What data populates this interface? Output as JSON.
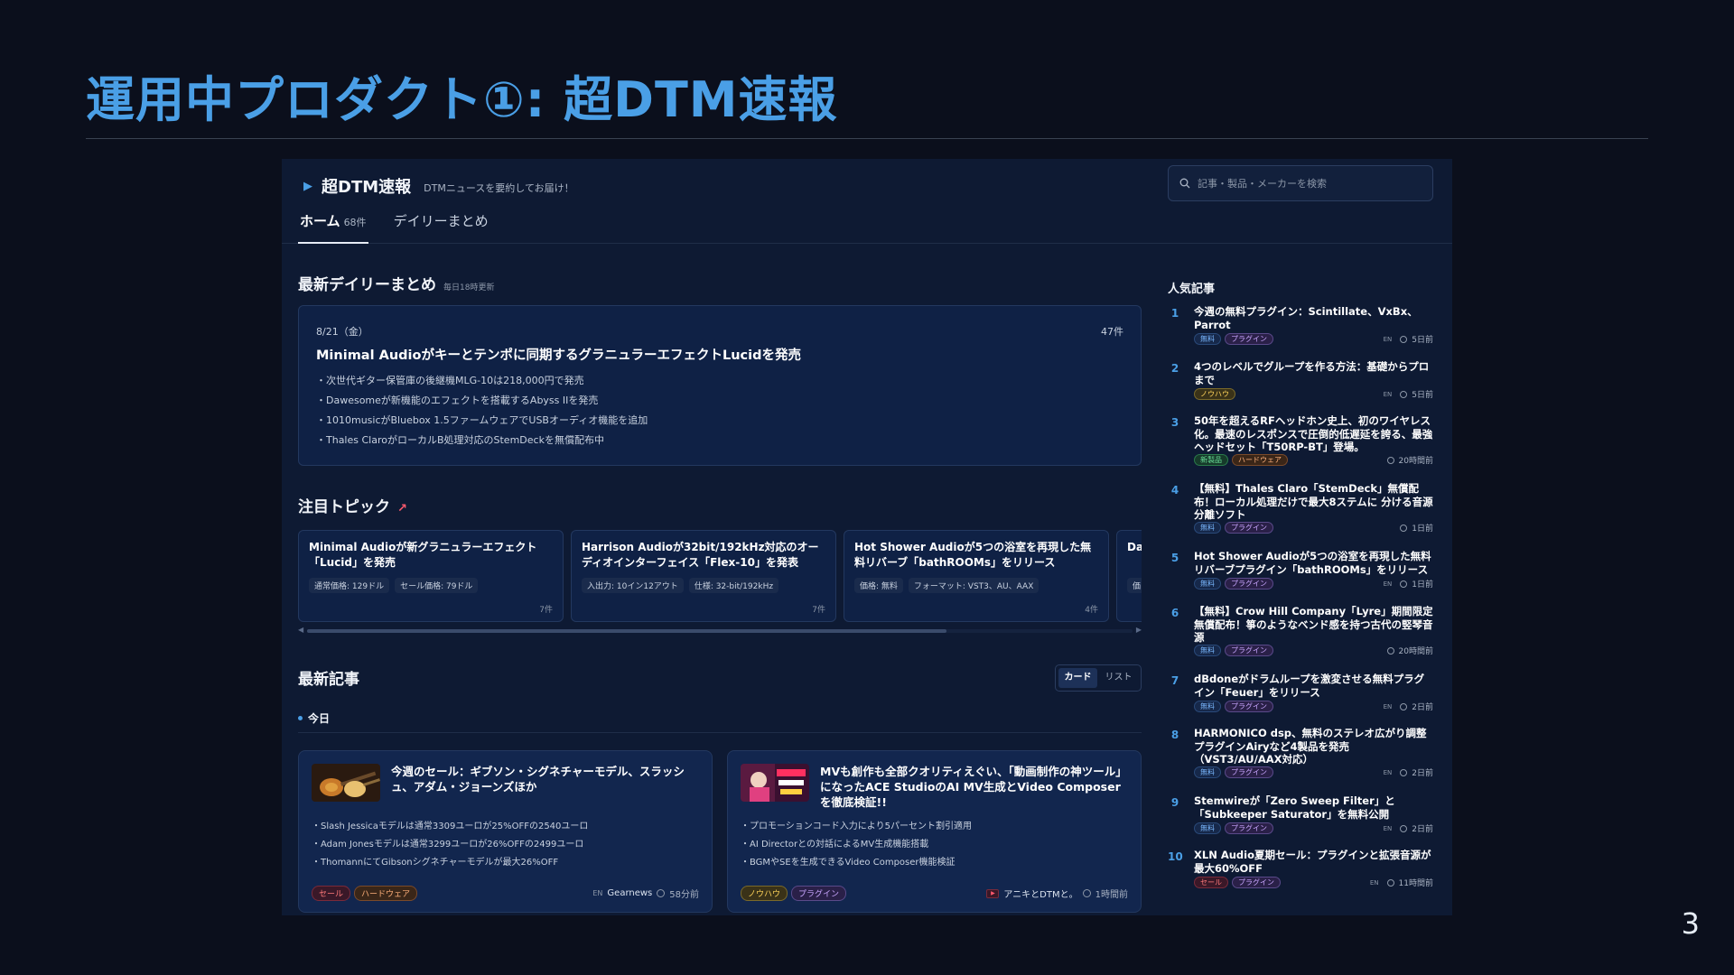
{
  "slide": {
    "title": "運用中プロダクト①: 超DTM速報",
    "page_number": "3"
  },
  "app": {
    "brand": "超DTM速報",
    "tagline": "DTMニュースを要約してお届け！",
    "search_placeholder": "記事・製品・メーカーを検索",
    "tabs": [
      {
        "label": "ホーム",
        "count": "68件"
      },
      {
        "label": "デイリーまとめ"
      }
    ]
  },
  "daily": {
    "title": "最新デイリーまとめ",
    "subtitle": "毎日18時更新",
    "date": "8/21（金）",
    "count": "47件",
    "headline": "Minimal Audioがキーとテンポに同期するグラニュラーエフェクトLucidを発売",
    "bullets": [
      "・次世代ギター保管庫の後継機MLG-10は218,000円で発売",
      "・Dawesomeが新機能のエフェクトを搭載するAbyss IIを発売",
      "・1010musicがBluebox 1.5ファームウェアでUSBオーディオ機能を追加",
      "・Thales ClaroがローカルB処理対応のStemDeckを無償配布中"
    ]
  },
  "topics": {
    "title": "注目トピック",
    "items": [
      {
        "title": "Minimal Audioが新グラニュラーエフェクト「Lucid」を発売",
        "meta": [
          "通常価格: 129ドル",
          "セール価格: 79ドル"
        ],
        "count": "7件"
      },
      {
        "title": "Harrison Audioが32bit/192kHz対応のオーディオインターフェイス「Flex-10」を発表",
        "meta": [
          "入出力: 10イン12アウト",
          "仕様: 32-bit/192kHz"
        ],
        "count": "7件"
      },
      {
        "title": "Hot Shower Audioが5つの浴室を再現した無料リバーブ「bathROOMs」をリリース",
        "meta": [
          "価格: 無料",
          "フォーマット: VST3、AU、AAX"
        ],
        "count": "4件"
      },
      {
        "title": "Da…を発…",
        "meta": [
          "価…"
        ],
        "count": ""
      }
    ]
  },
  "latest": {
    "title": "最新記事",
    "view_options": [
      "カード",
      "リスト"
    ],
    "day_label": "今日",
    "articles": [
      {
        "title": "今週のセール：ギブソン・シグネチャーモデル、スラッシュ、アダム・ジョーンズほか",
        "bullets": [
          "・Slash Jessicaモデルは通常3309ユーロが25%OFFの2540ユーロ",
          "・Adam Jonesモデルは通常3299ユーロが26%OFFの2499ユーロ",
          "・ThomannにてGibsonシグネチャーモデルが最大26%OFF"
        ],
        "tags": [
          "セール",
          "ハードウェア"
        ],
        "lang": "EN",
        "source": "Gearnews",
        "time": "58分前"
      },
      {
        "title": "MVも創作も全部クオリティえぐい、「動画制作の神ツール」になったACE StudioのAI MV生成とVideo Composerを徹底検証!!",
        "bullets": [
          "・プロモーションコード入力により5パーセント割引適用",
          "・AI Directorとの対話によるMV生成機能搭載",
          "・BGMやSEを生成できるVideo Composer機能検証"
        ],
        "tags": [
          "ノウハウ",
          "プラグイン"
        ],
        "source": "アニキとDTMと。",
        "time": "1時間前"
      }
    ]
  },
  "popular": {
    "title": "人気記事",
    "items": [
      {
        "rank": "1",
        "title": "今週の無料プラグイン：Scintillate、VxBx、Parrot",
        "tags": [
          "無料",
          "プラグイン"
        ],
        "lang": "EN",
        "time": "5日前"
      },
      {
        "rank": "2",
        "title": "4つのレベルでグループを作る方法：基礎からプロまで",
        "tags": [
          "ノウハウ"
        ],
        "lang": "EN",
        "time": "5日前"
      },
      {
        "rank": "3",
        "title": "50年を超えるRFヘッドホン史上、初のワイヤレス化。最速のレスポンスで圧倒的低遅延を誇る、最強ヘッドセット「T50RP-BT」登場。",
        "tags": [
          "新製品",
          "ハードウェア"
        ],
        "lang": "",
        "time": "20時間前"
      },
      {
        "rank": "4",
        "title": "【無料】Thales Claro「StemDeck」無償配布！ローカル処理だけで最大8ステムに 分ける音源分離ソフト",
        "tags": [
          "無料",
          "プラグイン"
        ],
        "lang": "",
        "time": "1日前"
      },
      {
        "rank": "5",
        "title": "Hot Shower Audioが5つの浴室を再現した無料リバーブプラグイン「bathROOMs」をリリース",
        "tags": [
          "無料",
          "プラグイン"
        ],
        "lang": "EN",
        "time": "1日前"
      },
      {
        "rank": "6",
        "title": "【無料】Crow Hill Company「Lyre」期間限定無償配布！箏のようなベンド感を持つ古代の竪琴音源",
        "tags": [
          "無料",
          "プラグイン"
        ],
        "lang": "",
        "time": "20時間前"
      },
      {
        "rank": "7",
        "title": "dBdoneがドラムループを激変させる無料プラグイン「Feuer」をリリース",
        "tags": [
          "無料",
          "プラグイン"
        ],
        "lang": "EN",
        "time": "2日前"
      },
      {
        "rank": "8",
        "title": "HARMONICO dsp、無料のステレオ広がり調整プラグインAiryなど4製品を発売（VST3/AU/AAX対応）",
        "tags": [
          "無料",
          "プラグイン"
        ],
        "lang": "EN",
        "time": "2日前"
      },
      {
        "rank": "9",
        "title": "Stemwireが「Zero Sweep Filter」と「Subkeeper Saturator」を無料公開",
        "tags": [
          "無料",
          "プラグイン"
        ],
        "lang": "EN",
        "time": "2日前"
      },
      {
        "rank": "10",
        "title": "XLN Audio夏期セール：プラグインと拡張音源が最大60%OFF",
        "tags": [
          "セール",
          "プラグイン"
        ],
        "lang": "EN",
        "time": "11時間前"
      }
    ]
  }
}
